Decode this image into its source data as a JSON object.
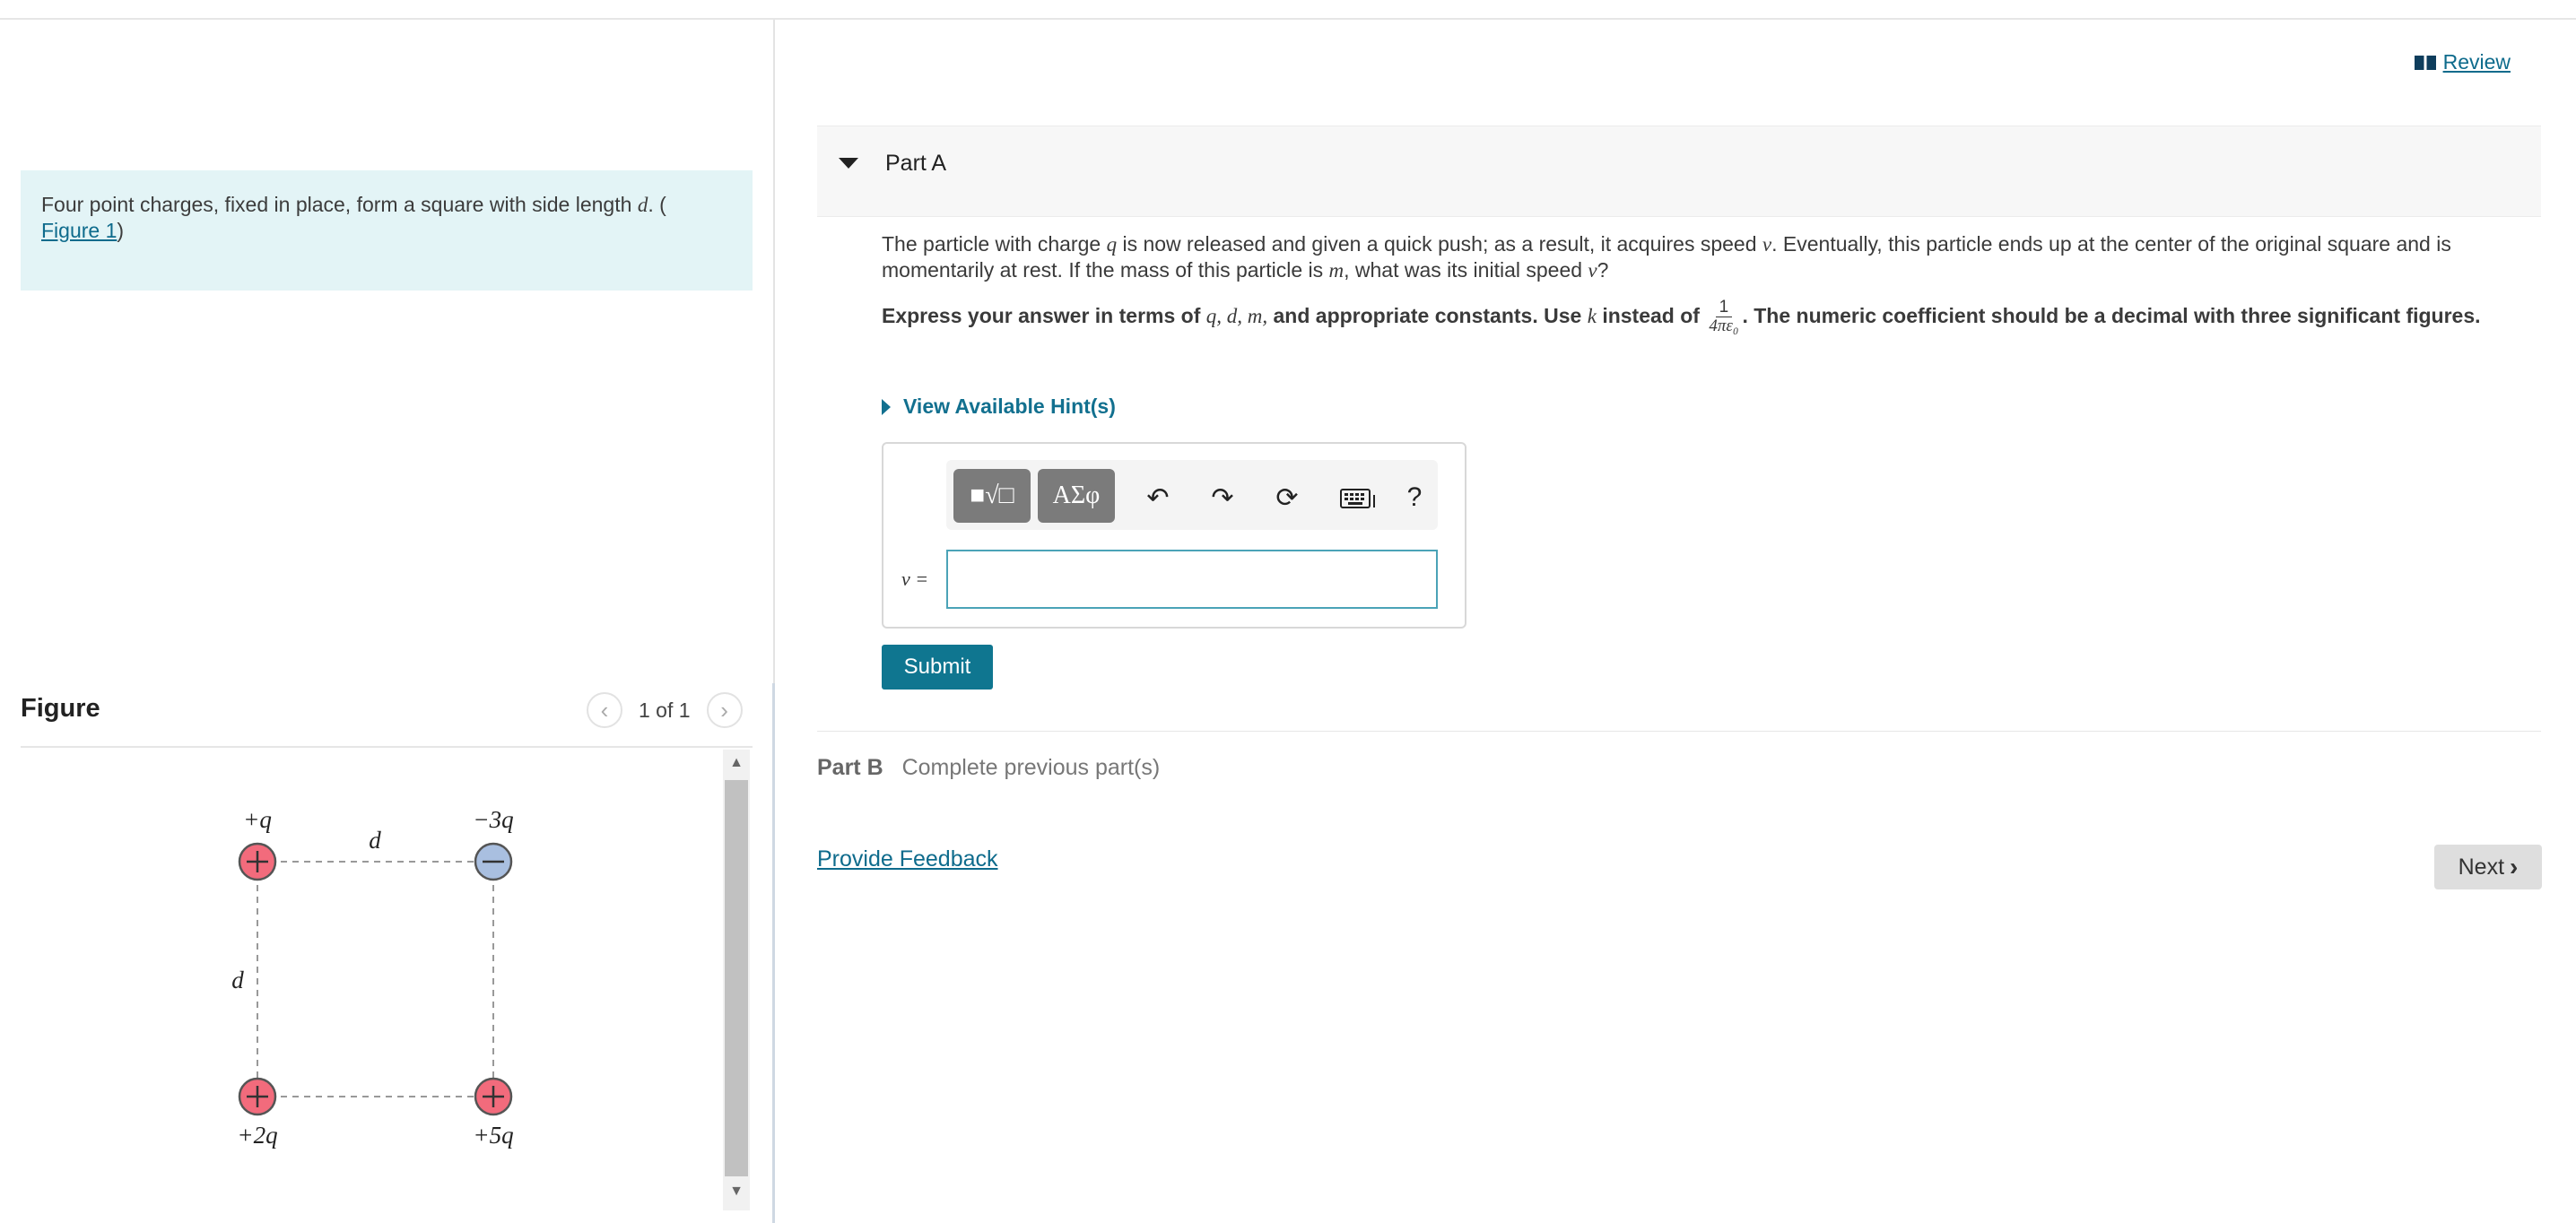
{
  "review": {
    "label": "Review"
  },
  "intro": {
    "text": "Four point charges, fixed in place, form a square with side length",
    "var": "d",
    "after": ". (",
    "link": "Figure 1",
    "close": ")"
  },
  "figure": {
    "title": "Figure",
    "counter": "1 of 1",
    "charges": {
      "top_left": "+q",
      "top_right": "−3q",
      "bottom_left": "+2q",
      "bottom_right": "+5q"
    },
    "side_label": "d"
  },
  "partA": {
    "title": "Part A",
    "problem_1": "The particle with charge",
    "problem_q": "q",
    "problem_2": "is now released and given a quick push; as a result, it acquires speed",
    "problem_v": "v",
    "problem_3": ". Eventually, this particle ends up at the center of the original square and is momentarily at rest. If the mass of this particle is",
    "problem_m": "m",
    "problem_4": ", what was its initial speed",
    "problem_v2": "v",
    "problem_5": "?",
    "instr_1": "Express your answer in terms of",
    "instr_vars": "q, d, m,",
    "instr_2": "and appropriate constants. Use",
    "instr_k": "k",
    "instr_3": "instead of",
    "frac_num": "1",
    "frac_den": "4πε₀",
    "instr_4": ". The numeric coefficient should be a decimal with three significant figures.",
    "hint": "View Available Hint(s)",
    "answer_label": "v =",
    "answer_value": "",
    "submit": "Submit",
    "toolbar": {
      "templates": "■√□",
      "symbols": "ΑΣφ",
      "help": "?"
    }
  },
  "partB": {
    "title": "Part B",
    "status": "Complete previous part(s)"
  },
  "feedback": "Provide Feedback",
  "next": "Next",
  "colors": {
    "accent": "#0f7690",
    "positive": "#f26b7c",
    "negative": "#a9bfe0"
  }
}
